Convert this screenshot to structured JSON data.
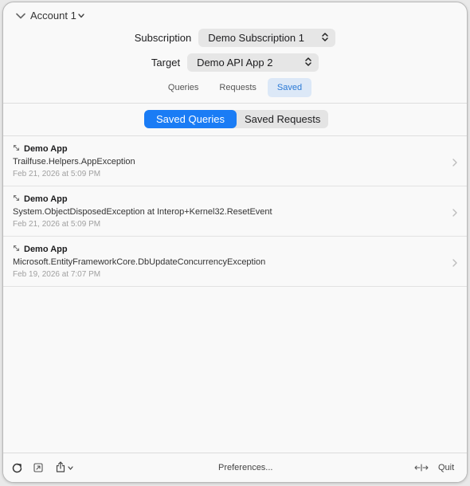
{
  "account": {
    "label": "Account 1"
  },
  "form": {
    "subscription_label": "Subscription",
    "subscription_value": "Demo Subscription 1",
    "target_label": "Target",
    "target_value": "Demo API App 2"
  },
  "tabs": [
    {
      "label": "Queries",
      "active": false
    },
    {
      "label": "Requests",
      "active": false
    },
    {
      "label": "Saved",
      "active": true
    }
  ],
  "segmented": {
    "selected": "Saved Queries",
    "options": [
      "Saved Queries",
      "Saved Requests"
    ]
  },
  "items": [
    {
      "app": "Demo App",
      "detail": "Trailfuse.Helpers.AppException",
      "date": "Feb 21, 2026 at 5:09 PM"
    },
    {
      "app": "Demo App",
      "detail": "System.ObjectDisposedException at Interop+Kernel32.ResetEvent",
      "date": "Feb 21, 2026 at 5:09 PM"
    },
    {
      "app": "Demo App",
      "detail": "Microsoft.EntityFrameworkCore.DbUpdateConcurrencyException",
      "date": "Feb 19, 2026 at 7:07 PM"
    }
  ],
  "footer": {
    "preferences": "Preferences...",
    "quit": "Quit"
  },
  "colors": {
    "accent": "#1a7cf5",
    "tab_active_bg": "#dce8f7",
    "tab_active_text": "#2a79d6"
  },
  "icons": {
    "header": [
      "chevron-down-icon",
      "small-chevron-down-icon"
    ],
    "items": [
      "link-icon",
      "chevron-right-icon"
    ],
    "footer": [
      "refresh-icon",
      "open-external-icon",
      "share-icon",
      "resize-width-icon"
    ]
  }
}
